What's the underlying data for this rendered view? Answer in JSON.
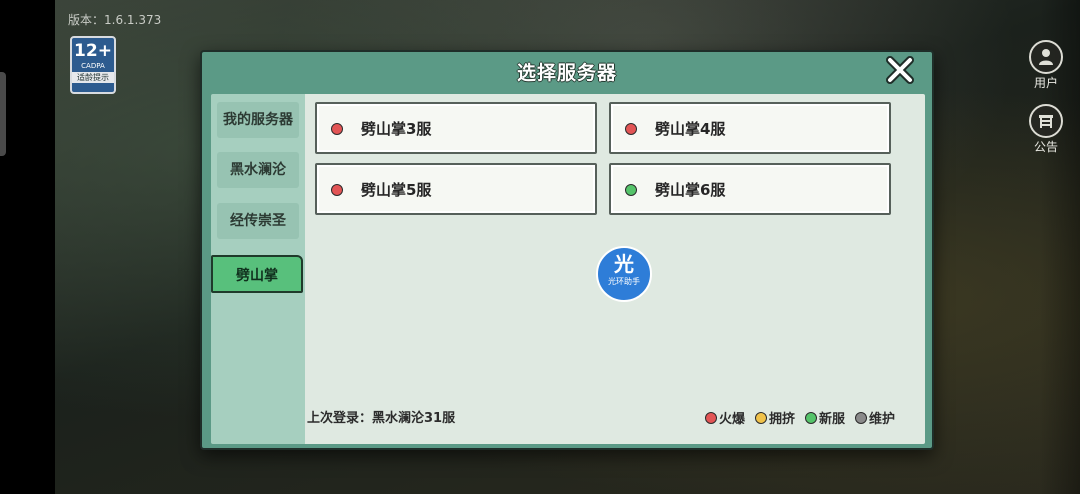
{
  "version": "版本：1.6.1.373",
  "age_rating": {
    "number": "12+",
    "org": "CADPA",
    "tip": "适龄提示"
  },
  "top_buttons": {
    "user": "用户",
    "notice": "公告"
  },
  "dialog": {
    "title": "选择服务器",
    "tabs": [
      {
        "label": "我的服务器",
        "active": false
      },
      {
        "label": "黑水澜沦",
        "active": false
      },
      {
        "label": "经传崇圣",
        "active": false
      },
      {
        "label": "劈山掌",
        "active": true
      }
    ],
    "servers": [
      {
        "name": "劈山掌3服",
        "status": "火爆"
      },
      {
        "name": "劈山掌4服",
        "status": "火爆"
      },
      {
        "name": "劈山掌5服",
        "status": "火爆"
      },
      {
        "name": "劈山掌6服",
        "status": "新服"
      }
    ],
    "last_login": "上次登录：黑水澜沦31服",
    "legend": [
      {
        "label": "火爆",
        "color": "#e25555"
      },
      {
        "label": "拥挤",
        "color": "#f0c24a"
      },
      {
        "label": "新服",
        "color": "#55c46a"
      },
      {
        "label": "维护",
        "color": "#8a8a8a"
      }
    ]
  },
  "helper_badge": {
    "char": "光",
    "label": "光环助手"
  },
  "colors": {
    "hot": "#e25555",
    "new": "#55c46a",
    "dialog_bg": "#5b9a86",
    "active_tab": "#58c07c"
  }
}
